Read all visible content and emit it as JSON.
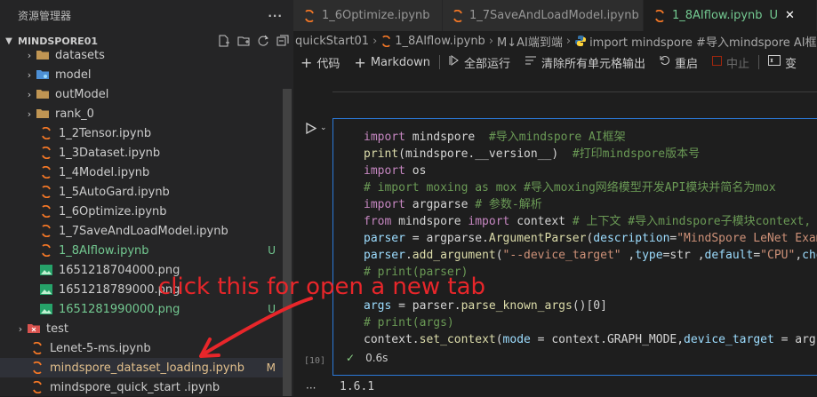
{
  "sidebar": {
    "title": "资源管理器",
    "more_label": "···",
    "section_title": "MINDSPORE01",
    "items": [
      {
        "label": "datasets",
        "type": "folder",
        "icon": "folder-icon",
        "badge": ""
      },
      {
        "label": "model",
        "type": "folder",
        "icon": "folder-icon",
        "badge": ""
      },
      {
        "label": "outModel",
        "type": "folder",
        "icon": "folder-icon",
        "badge": ""
      },
      {
        "label": "rank_0",
        "type": "folder",
        "icon": "folder-icon",
        "badge": ""
      },
      {
        "label": "1_2Tensor.ipynb",
        "type": "notebook",
        "icon": "notebook-icon",
        "badge": ""
      },
      {
        "label": "1_3Dataset.ipynb",
        "type": "notebook",
        "icon": "notebook-icon",
        "badge": ""
      },
      {
        "label": "1_4Model.ipynb",
        "type": "notebook",
        "icon": "notebook-icon",
        "badge": ""
      },
      {
        "label": "1_5AutoGard.ipynb",
        "type": "notebook",
        "icon": "notebook-icon",
        "badge": ""
      },
      {
        "label": "1_6Optimize.ipynb",
        "type": "notebook",
        "icon": "notebook-icon",
        "badge": ""
      },
      {
        "label": "1_7SaveAndLoadModel.ipynb",
        "type": "notebook",
        "icon": "notebook-icon",
        "badge": ""
      },
      {
        "label": "1_8AIflow.ipynb",
        "type": "notebook",
        "icon": "notebook-icon",
        "badge": "U"
      },
      {
        "label": "1651218704000.png",
        "type": "image",
        "icon": "image-icon",
        "badge": ""
      },
      {
        "label": "1651218789000.png",
        "type": "image",
        "icon": "image-icon",
        "badge": ""
      },
      {
        "label": "1651281990000.png",
        "type": "image",
        "icon": "image-icon",
        "badge": "U"
      },
      {
        "label": "test",
        "type": "folder",
        "icon": "folder-icon",
        "badge": ""
      },
      {
        "label": "Lenet-5-ms.ipynb",
        "type": "notebook",
        "icon": "notebook-icon",
        "badge": ""
      },
      {
        "label": "mindspore_dataset_loading.ipynb",
        "type": "notebook",
        "icon": "notebook-icon",
        "badge": "M"
      },
      {
        "label": "mindspore_quick_start .ipynb",
        "type": "notebook",
        "icon": "notebook-icon",
        "badge": ""
      }
    ]
  },
  "tabs": [
    {
      "label": "1_6Optimize.ipynb",
      "active": false
    },
    {
      "label": "1_7SaveAndLoadModel.ipynb",
      "active": false
    },
    {
      "label": "1_8AIflow.ipynb",
      "active": true,
      "badge": "U",
      "close": "✕"
    }
  ],
  "breadcrumb": {
    "folder": "quickStart01",
    "file": "1_8AIflow.ipynb",
    "section": "M↓AI端到端",
    "symbol": "import mindspore  #导入mindspore AI框架 print"
  },
  "toolbar": {
    "code": "代码",
    "markdown": "Markdown",
    "run_all": "全部运行",
    "clear_outputs": "清除所有单元格输出",
    "restart": "重启",
    "interrupt": "中止",
    "variables": "变"
  },
  "cell": {
    "execution_count": "[10]",
    "duration": "0.6s",
    "output": "1.6.1",
    "output_marker": "···"
  },
  "annotation": {
    "text": "click this for open a new tab"
  },
  "colors": {
    "accent": "#2b79d8",
    "untracked": "#73c991",
    "modified": "#e2c08d",
    "annotation": "#e8262a"
  }
}
